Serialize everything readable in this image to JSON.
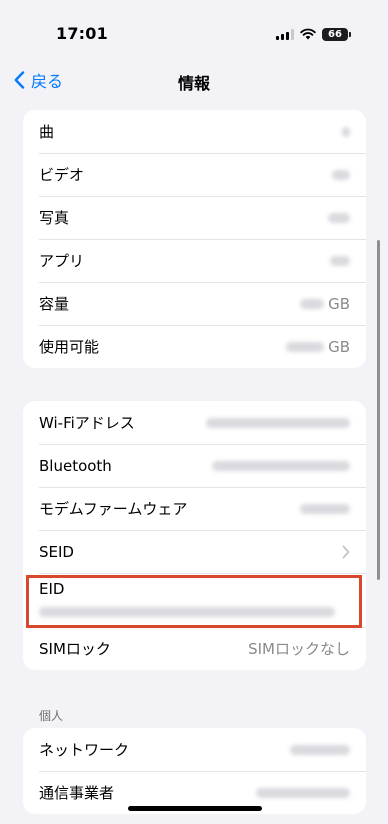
{
  "status": {
    "time": "17:01",
    "battery": "66"
  },
  "nav": {
    "back_label": "戻る",
    "title": "情報"
  },
  "group1": [
    {
      "label": "曲"
    },
    {
      "label": "ビデオ"
    },
    {
      "label": "写真"
    },
    {
      "label": "アプリ"
    },
    {
      "label": "容量",
      "unit": "GB"
    },
    {
      "label": "使用可能",
      "unit": "GB"
    }
  ],
  "group2": [
    {
      "label": "Wi-Fiアドレス"
    },
    {
      "label": "Bluetooth"
    },
    {
      "label": "モデムファームウェア"
    },
    {
      "label": "SEID"
    },
    {
      "label": "EID"
    },
    {
      "label": "SIMロック",
      "value": "SIMロックなし"
    }
  ],
  "section_personal": {
    "header": "個人"
  },
  "group3": [
    {
      "label": "ネットワーク"
    },
    {
      "label": "通信事業者"
    }
  ]
}
